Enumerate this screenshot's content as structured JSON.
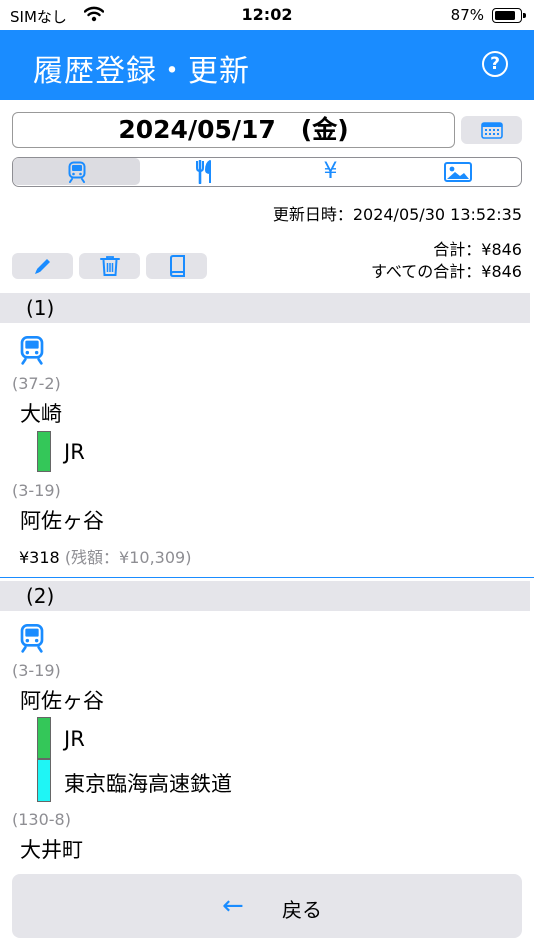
{
  "status_bar": {
    "carrier": "SIMなし",
    "time": "12:02",
    "battery": "87%"
  },
  "nav": {
    "title": "履歴登録・更新",
    "help_icon": "question-circle-icon"
  },
  "date": {
    "value": "2024/05/17　(金)",
    "calendar_icon": "calendar-icon"
  },
  "tabs": [
    {
      "icon": "train-icon",
      "active": true
    },
    {
      "icon": "fork-knife-icon",
      "active": false
    },
    {
      "icon": "yen-icon",
      "label": "¥",
      "active": false
    },
    {
      "icon": "image-icon",
      "active": false
    }
  ],
  "updated_at": "更新日時：2024/05/30 13:52:35",
  "toolbar": {
    "edit_icon": "pencil-icon",
    "delete_icon": "trash-icon",
    "book_icon": "book-icon"
  },
  "totals": {
    "total": "合計：¥846",
    "grand_total": "すべての合計：¥846"
  },
  "records": [
    {
      "header": "(1)",
      "from_code": "(37-2)",
      "from_name": "大崎",
      "lines": [
        {
          "name": "JR",
          "color": "#34c759"
        }
      ],
      "to_code": "(3-19)",
      "to_name": "阿佐ヶ谷",
      "fare": "¥318",
      "balance": "(残額：¥10,309)"
    },
    {
      "header": "(2)",
      "from_code": "(3-19)",
      "from_name": "阿佐ヶ谷",
      "lines": [
        {
          "name": "JR",
          "color": "#34c759"
        },
        {
          "name": "東京臨海高速鉄道",
          "color": "#1ff5f5"
        }
      ],
      "to_code": "(130-8)",
      "to_name": "大井町"
    }
  ],
  "back_button": {
    "arrow": "←",
    "label": "戻る"
  },
  "colors": {
    "accent": "#1a8cff",
    "section_bg": "#e5e5ea"
  }
}
